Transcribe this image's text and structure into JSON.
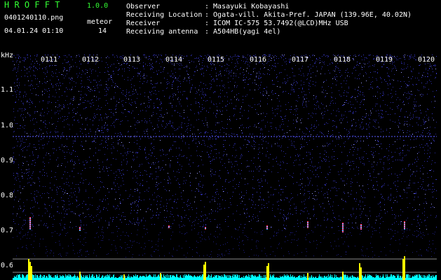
{
  "header": {
    "app_name": "H R O F F T",
    "version": "1.0.0",
    "filename": "0401240110.png",
    "datetime": "04.01.24 01:10",
    "counter_label": "meteor",
    "counter_value": "14"
  },
  "info": {
    "observer_label": "Observer",
    "observer_value": ": Masayuki Kobayashi",
    "location_label": "Receiving Location",
    "location_value": ": Ogata-vill. Akita-Pref. JAPAN (139.96E, 40.02N)",
    "receiver_label": "Receiver",
    "receiver_value": ": ICOM IC-575 53.7492(@LCD)MHz USB",
    "antenna_label": "Receiving antenna",
    "antenna_value": ": A504HB(yagi 4el)"
  },
  "spectrogram": {
    "y_unit": "kHz",
    "y_ticks": [
      "1.1",
      "1.0",
      "0.9",
      "0.8",
      "0.7",
      "0.6"
    ],
    "time_ticks": [
      "0111",
      "0112",
      "0113",
      "0114",
      "0115",
      "0116",
      "0117",
      "0118",
      "0119",
      "0120"
    ],
    "colors": {
      "background": "#000000",
      "noise": "#2a2aa0",
      "carrier": "#6a6aff",
      "meteor": "#ff3333",
      "baseline": "#00ffff",
      "peaks": "#ffff00"
    }
  }
}
